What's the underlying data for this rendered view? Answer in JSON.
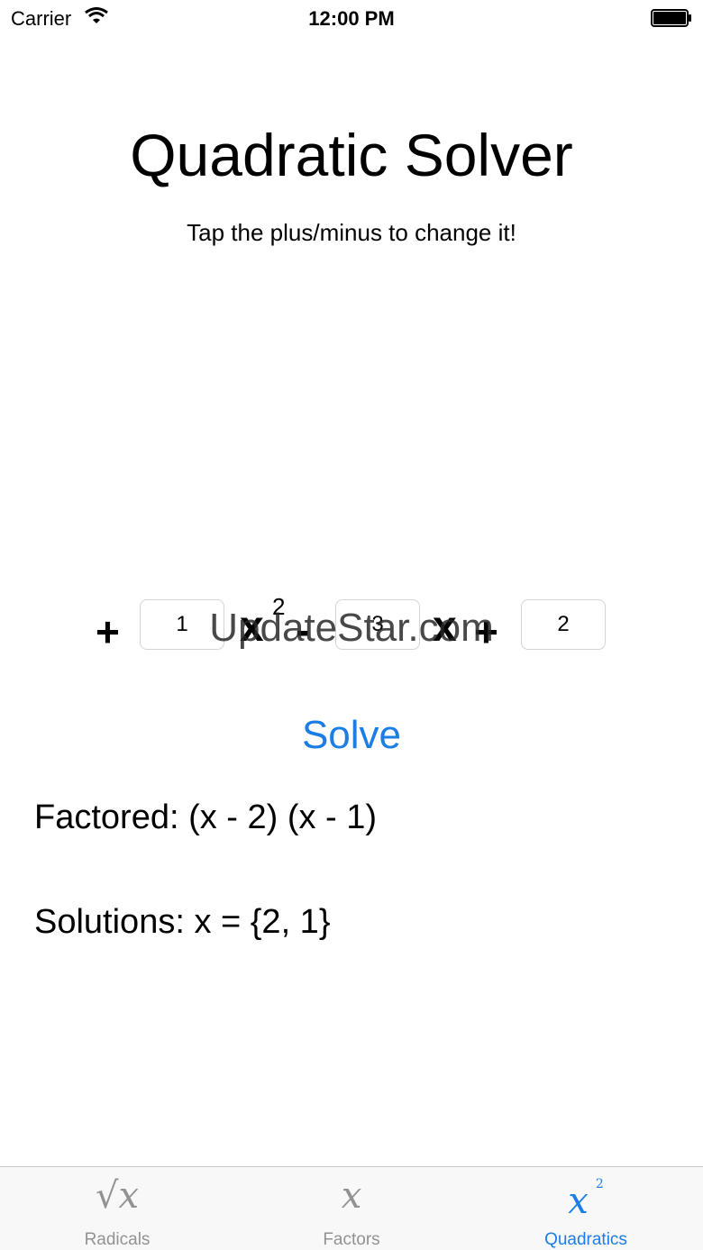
{
  "status_bar": {
    "carrier": "Carrier",
    "time": "12:00 PM"
  },
  "header": {
    "title": "Quadratic Solver",
    "subtitle": "Tap the plus/minus to change it!"
  },
  "equation": {
    "sign_a": "+",
    "coef_a": "1",
    "var_x2": "x",
    "exp": "2",
    "sign_b": "-",
    "coef_b": "3",
    "var_x": "x",
    "sign_c": "+",
    "coef_c": "2"
  },
  "watermark": "UpdateStar.com",
  "solve_label": "Solve",
  "results": {
    "factored": "Factored: (x - 2) (x - 1)",
    "solutions": "Solutions: x = {2, 1}"
  },
  "tabs": [
    {
      "label": "Radicals",
      "icon": "sqrt-x-icon",
      "glyph": "√x"
    },
    {
      "label": "Factors",
      "icon": "x-icon",
      "glyph": "x"
    },
    {
      "label": "Quadratics",
      "icon": "x-squared-icon",
      "glyph": "x",
      "sup": "2"
    }
  ],
  "colors": {
    "accent": "#1a7ee6",
    "inactive_tab": "#929292",
    "tab_bar_bg": "#f8f8f8"
  }
}
